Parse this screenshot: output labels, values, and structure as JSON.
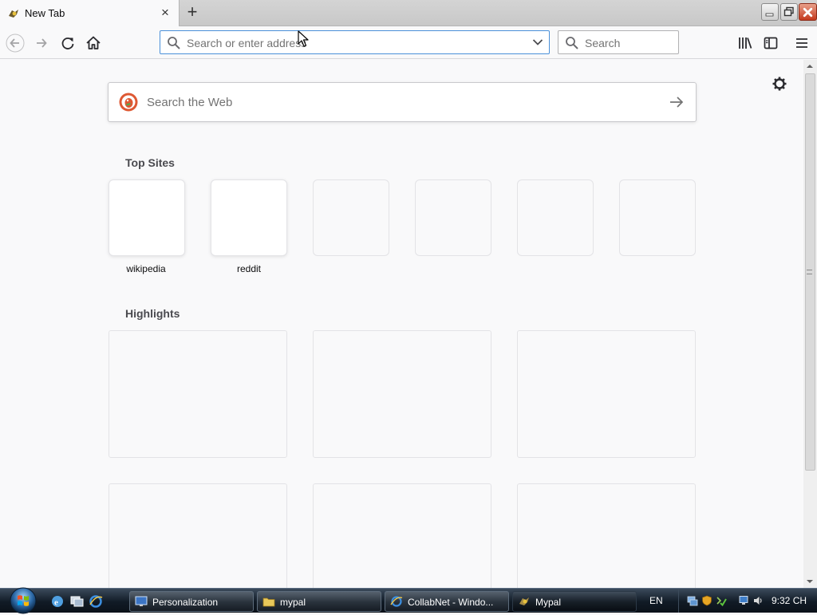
{
  "browser": {
    "tab": {
      "title": "New Tab",
      "close_label": "×"
    },
    "new_tab_label": "+",
    "urlbar": {
      "placeholder": "Search or enter address",
      "value": ""
    },
    "searchbar": {
      "placeholder": "Search",
      "value": ""
    }
  },
  "newtab": {
    "websearch_placeholder": "Search the Web",
    "top_sites_title": "Top Sites",
    "top_sites": [
      {
        "label": "wikipedia"
      },
      {
        "label": "reddit"
      },
      {
        "label": ""
      },
      {
        "label": ""
      },
      {
        "label": ""
      },
      {
        "label": ""
      }
    ],
    "highlights_title": "Highlights"
  },
  "taskbar": {
    "buttons": [
      {
        "label": "Personalization",
        "icon": "personalization-icon"
      },
      {
        "label": "mypal",
        "icon": "folder-icon"
      },
      {
        "label": "CollabNet - Windo...",
        "icon": "ie-icon"
      },
      {
        "label": "Mypal",
        "icon": "mypal-icon"
      }
    ],
    "language": "EN",
    "clock": "9:32 CH"
  },
  "colors": {
    "accent": "#4a90d9",
    "ddg": "#de5833",
    "taskbar": "#111b26"
  }
}
